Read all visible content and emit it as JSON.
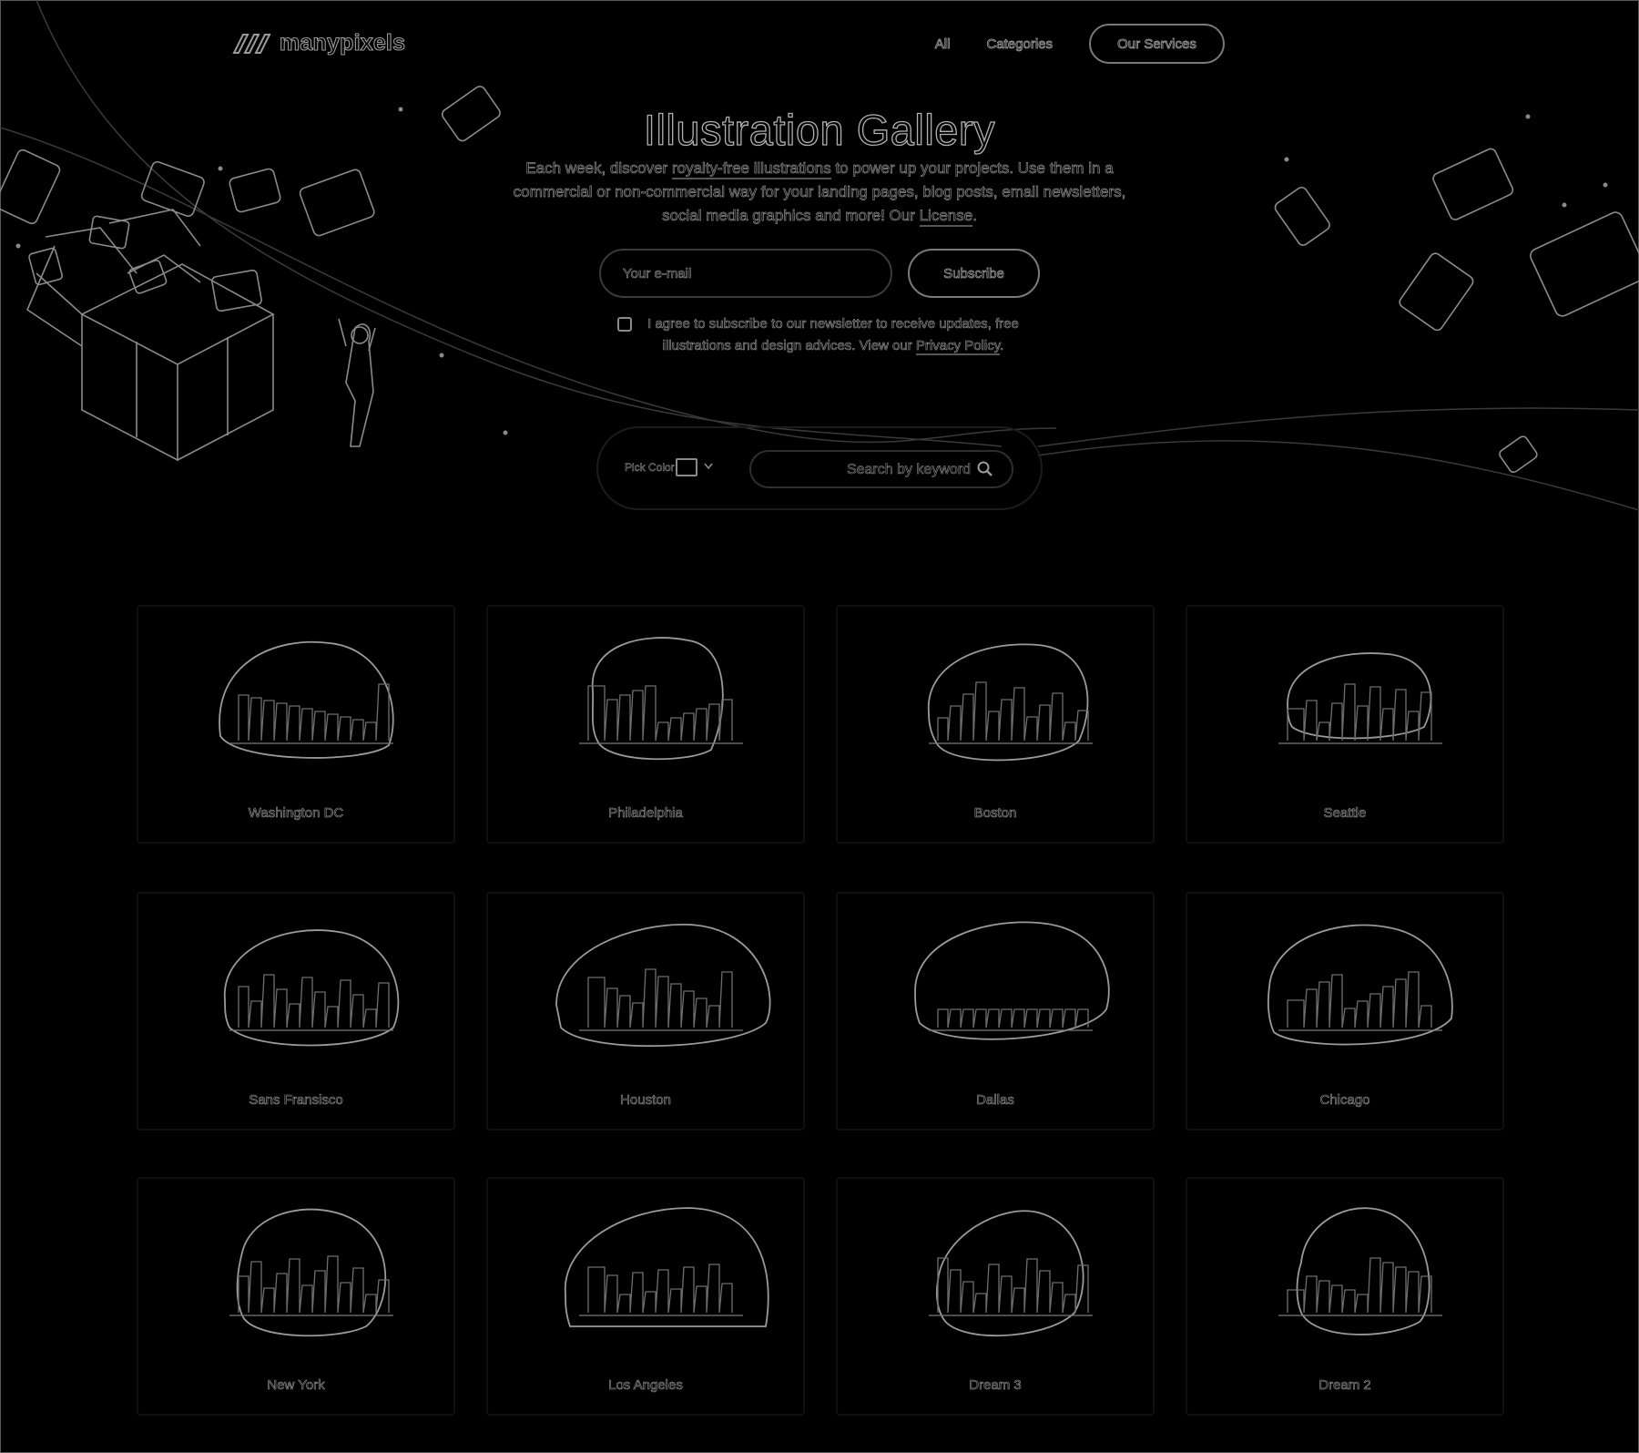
{
  "brand": {
    "name": "manypixels"
  },
  "nav": {
    "all": "All",
    "categories": "Categories",
    "services": "Our Services"
  },
  "hero": {
    "title": "Illustration Gallery",
    "desc_1": "Each week, discover ",
    "desc_link_1": "royalty-free illustrations",
    "desc_2": " to power up your projects. Use them in a commercial or non-commercial way for your landing pages, blog posts, email newsletters, social media graphics and more! Our ",
    "desc_link_2": "License",
    "desc_3": "."
  },
  "newsletter": {
    "email_placeholder": "Your e-mail",
    "subscribe_label": "Subscribe",
    "agree_text": "I agree to subscribe to our newsletter to receive updates, free illustrations and design advices. View our ",
    "privacy_link": "Privacy Policy",
    "agree_end": "."
  },
  "filter": {
    "pick_color_label": "Pick Color",
    "search_placeholder": "Search by keyword"
  },
  "gallery": [
    {
      "label": "Washington DC"
    },
    {
      "label": "Philadelphia"
    },
    {
      "label": "Boston"
    },
    {
      "label": "Seattle"
    },
    {
      "label": "Sans Fransisco"
    },
    {
      "label": "Houston"
    },
    {
      "label": "Dallas"
    },
    {
      "label": "Chicago"
    },
    {
      "label": "New York"
    },
    {
      "label": "Los Angeles"
    },
    {
      "label": "Dream 3"
    },
    {
      "label": "Dream 2"
    }
  ],
  "icons": {
    "logo": "logo-stripes-icon",
    "search": "search-icon",
    "caret": "chevron-down-icon"
  },
  "colors": {
    "background": "#000000",
    "line": "#9a9a9a"
  }
}
